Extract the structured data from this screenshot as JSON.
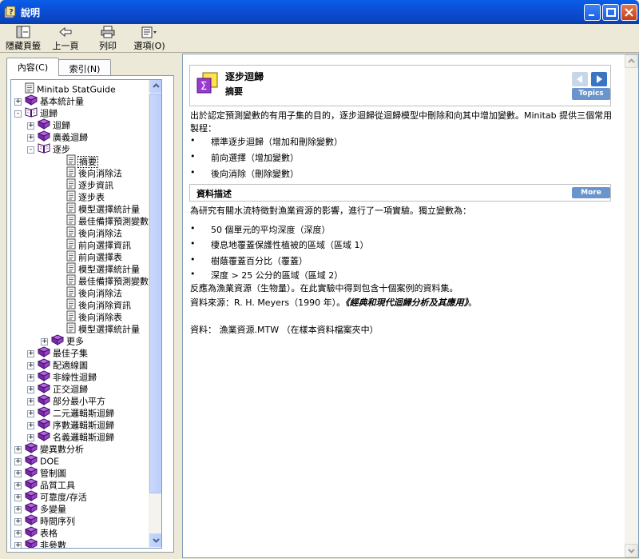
{
  "window": {
    "title": "說明"
  },
  "toolbar": {
    "hide": "隱藏頁籤",
    "back": "上一頁",
    "print": "列印",
    "options": "選項(O)"
  },
  "tabs": {
    "contents": "內容(C)",
    "index": "索引(N)"
  },
  "tree": [
    {
      "label": "Minitab StatGuide",
      "level": 0,
      "icon": "page-icon",
      "toggle": ""
    },
    {
      "label": "基本統計量",
      "level": 0,
      "icon": "book-closed-icon",
      "toggle": "+"
    },
    {
      "label": "迴歸",
      "level": 0,
      "icon": "book-open-icon",
      "toggle": "-"
    },
    {
      "label": "迴歸",
      "level": 1,
      "icon": "book-closed-icon",
      "toggle": "+"
    },
    {
      "label": "廣義迴歸",
      "level": 1,
      "icon": "book-closed-icon",
      "toggle": "+"
    },
    {
      "label": "逐步",
      "level": 1,
      "icon": "book-open-icon",
      "toggle": "-"
    },
    {
      "label": "摘要",
      "level": 2,
      "icon": "page-icon",
      "toggle": "",
      "selected": true
    },
    {
      "label": "後向消除法",
      "level": 2,
      "icon": "page-icon",
      "toggle": ""
    },
    {
      "label": "逐步資訊",
      "level": 2,
      "icon": "page-icon",
      "toggle": ""
    },
    {
      "label": "逐步表",
      "level": 2,
      "icon": "page-icon",
      "toggle": ""
    },
    {
      "label": "模型選擇統計量",
      "level": 2,
      "icon": "page-icon",
      "toggle": ""
    },
    {
      "label": "最佳備擇預測變數表",
      "level": 2,
      "icon": "page-icon",
      "toggle": ""
    },
    {
      "label": "後向消除法",
      "level": 2,
      "icon": "page-icon",
      "toggle": ""
    },
    {
      "label": "前向選擇資訊",
      "level": 2,
      "icon": "page-icon",
      "toggle": ""
    },
    {
      "label": "前向選擇表",
      "level": 2,
      "icon": "page-icon",
      "toggle": ""
    },
    {
      "label": "模型選擇統計量",
      "level": 2,
      "icon": "page-icon",
      "toggle": ""
    },
    {
      "label": "最佳備擇預測變數表",
      "level": 2,
      "icon": "page-icon",
      "toggle": ""
    },
    {
      "label": "後向消除法",
      "level": 2,
      "icon": "page-icon",
      "toggle": ""
    },
    {
      "label": "後向消除資訊",
      "level": 2,
      "icon": "page-icon",
      "toggle": ""
    },
    {
      "label": "後向消除表",
      "level": 2,
      "icon": "page-icon",
      "toggle": ""
    },
    {
      "label": "模型選擇統計量",
      "level": 2,
      "icon": "page-icon",
      "toggle": ""
    },
    {
      "label": "更多",
      "level": 2,
      "icon": "book-closed-icon",
      "toggle": "+"
    },
    {
      "label": "最佳子集",
      "level": 1,
      "icon": "book-closed-icon",
      "toggle": "+"
    },
    {
      "label": "配適線圖",
      "level": 1,
      "icon": "book-closed-icon",
      "toggle": "+"
    },
    {
      "label": "非線性迴歸",
      "level": 1,
      "icon": "book-closed-icon",
      "toggle": "+"
    },
    {
      "label": "正交迴歸",
      "level": 1,
      "icon": "book-closed-icon",
      "toggle": "+"
    },
    {
      "label": "部分最小平方",
      "level": 1,
      "icon": "book-closed-icon",
      "toggle": "+"
    },
    {
      "label": "二元邏輯斯迴歸",
      "level": 1,
      "icon": "book-closed-icon",
      "toggle": "+"
    },
    {
      "label": "序數邏輯斯迴歸",
      "level": 1,
      "icon": "book-closed-icon",
      "toggle": "+"
    },
    {
      "label": "名義邏輯斯迴歸",
      "level": 1,
      "icon": "book-closed-icon",
      "toggle": "+"
    },
    {
      "label": "變異數分析",
      "level": 0,
      "icon": "book-closed-icon",
      "toggle": "+"
    },
    {
      "label": "DOE",
      "level": 0,
      "icon": "book-closed-icon",
      "toggle": "+"
    },
    {
      "label": "管制圖",
      "level": 0,
      "icon": "book-closed-icon",
      "toggle": "+"
    },
    {
      "label": "品質工具",
      "level": 0,
      "icon": "book-closed-icon",
      "toggle": "+"
    },
    {
      "label": "可靠度/存活",
      "level": 0,
      "icon": "book-closed-icon",
      "toggle": "+"
    },
    {
      "label": "多變量",
      "level": 0,
      "icon": "book-closed-icon",
      "toggle": "+"
    },
    {
      "label": "時間序列",
      "level": 0,
      "icon": "book-closed-icon",
      "toggle": "+"
    },
    {
      "label": "表格",
      "level": 0,
      "icon": "book-closed-icon",
      "toggle": "+"
    },
    {
      "label": "非參數",
      "level": 0,
      "icon": "book-closed-icon",
      "toggle": "+"
    }
  ],
  "content": {
    "title": "逐步迴歸",
    "subtitle": "摘要",
    "topics": "Topics",
    "intro": "出於認定預測變數的有用子集的目的，逐步迴歸從迴歸模型中刪除和向其中增加變數。Minitab 提供三個常用製程：",
    "methods": [
      "標準逐步迴歸（增加和刪除變數）",
      "前向選擇（增加變數）",
      "後向消除（刪除變數）"
    ],
    "section_title": "資料描述",
    "more": "More",
    "desc": "為研究有關水流特徵對漁業資源的影響，進行了一項實驗。獨立變數為：",
    "vars": [
      "50 個單元的平均深度（深度）",
      "棲息地覆蓋保護性植被的區域（區域 1）",
      "樹蔭覆蓋百分比（覆蓋）",
      "深度 > 25 公分的區域（區域 2）"
    ],
    "response": "反應為漁業資源（生物量）。在此實驗中得到包含十個案例的資料集。",
    "source_prefix": "資料來源：R. H. Meyers（1990 年）。",
    "source_book": "《經典和現代迴歸分析及其應用》",
    "source_suffix": "。",
    "data_file": "資料： 漁業資源.MTW （在樣本資料檔案夾中）"
  }
}
